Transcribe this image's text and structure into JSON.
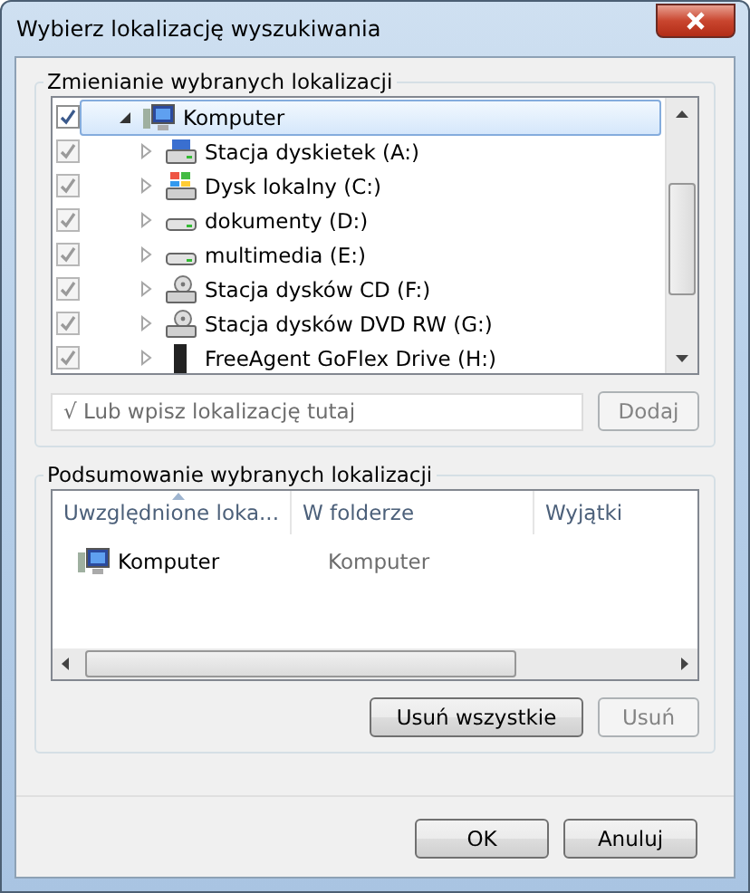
{
  "window": {
    "title": "Wybierz lokalizację wyszukiwania"
  },
  "locations": {
    "title": "Zmienianie wybranych lokalizacji",
    "tree": [
      {
        "label": "Komputer",
        "kind": "computer",
        "checked": true,
        "disabled": false,
        "selected": true,
        "expanded": true,
        "children": [
          {
            "label": "Stacja dyskietek (A:)",
            "kind": "floppy",
            "checked": true,
            "disabled": true,
            "selected": false,
            "expanded": false
          },
          {
            "label": "Dysk lokalny (C:)",
            "kind": "system-drive",
            "checked": true,
            "disabled": true,
            "selected": false,
            "expanded": false
          },
          {
            "label": "dokumenty (D:)",
            "kind": "drive",
            "checked": true,
            "disabled": true,
            "selected": false,
            "expanded": false
          },
          {
            "label": "multimedia (E:)",
            "kind": "drive",
            "checked": true,
            "disabled": true,
            "selected": false,
            "expanded": false
          },
          {
            "label": "Stacja dysków CD (F:)",
            "kind": "optical",
            "checked": true,
            "disabled": true,
            "selected": false,
            "expanded": false
          },
          {
            "label": "Stacja dysków DVD RW (G:)",
            "kind": "optical",
            "checked": true,
            "disabled": true,
            "selected": false,
            "expanded": false
          },
          {
            "label": "FreeAgent GoFlex Drive (H:)",
            "kind": "external",
            "checked": true,
            "disabled": true,
            "selected": false,
            "expanded": false
          }
        ]
      }
    ],
    "address": {
      "placeholder": "√ Lub wpisz lokalizację tutaj"
    },
    "add_button": {
      "label": "Dodaj",
      "disabled": true
    }
  },
  "summary": {
    "title": "Podsumowanie wybranych lokalizacji",
    "columns": [
      {
        "label": "Uwzględnione loka...",
        "sorted": true
      },
      {
        "label": "W folderze",
        "sorted": false
      },
      {
        "label": "Wyjątki",
        "sorted": false
      }
    ],
    "rows": [
      {
        "name": "Komputer",
        "kind": "computer",
        "folder": "Komputer"
      }
    ],
    "buttons": [
      {
        "label": "Usuń wszystkie",
        "disabled": false
      },
      {
        "label": "Usuń",
        "disabled": true
      }
    ]
  },
  "footer_buttons": [
    {
      "label": "OK"
    },
    {
      "label": "Anuluj"
    }
  ]
}
